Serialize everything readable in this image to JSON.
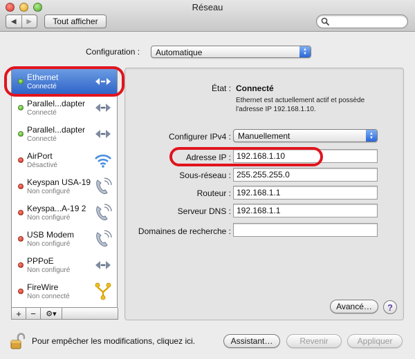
{
  "window": {
    "title": "Réseau"
  },
  "toolbar": {
    "back_glyph": "◀",
    "forward_glyph": "▶",
    "show_all_label": "Tout afficher",
    "search": {
      "value": "",
      "placeholder": ""
    }
  },
  "configuration": {
    "label": "Configuration :",
    "value": "Automatique"
  },
  "sidebar": {
    "items": [
      {
        "name": "Ethernet",
        "status": "Connecté",
        "indicator": "green",
        "icon": "ethernet-arrows-icon",
        "selected": true
      },
      {
        "name": "Parallel...dapter",
        "status": "Connecté",
        "indicator": "green",
        "icon": "ethernet-arrows-icon",
        "selected": false
      },
      {
        "name": "Parallel...dapter",
        "status": "Connecté",
        "indicator": "green",
        "icon": "ethernet-arrows-icon",
        "selected": false
      },
      {
        "name": "AirPort",
        "status": "Désactivé",
        "indicator": "red",
        "icon": "wifi-icon",
        "selected": false
      },
      {
        "name": "Keyspan USA-19",
        "status": "Non configuré",
        "indicator": "red",
        "icon": "phone-icon",
        "selected": false
      },
      {
        "name": "Keyspa...A-19 2",
        "status": "Non configuré",
        "indicator": "red",
        "icon": "phone-icon",
        "selected": false
      },
      {
        "name": "USB Modem",
        "status": "Non configuré",
        "indicator": "red",
        "icon": "phone-icon",
        "selected": false
      },
      {
        "name": "PPPoE",
        "status": "Non configuré",
        "indicator": "red",
        "icon": "ethernet-arrows-icon",
        "selected": false
      },
      {
        "name": "FireWire",
        "status": "Non connecté",
        "indicator": "red",
        "icon": "firewire-icon",
        "selected": false
      }
    ],
    "toolbar": {
      "add": "+",
      "remove": "−",
      "action": "⚙▾"
    }
  },
  "details": {
    "state_label": "État :",
    "state_value": "Connecté",
    "state_description": "Ethernet est actuellement actif et possède l'adresse IP 192.168.1.10.",
    "ipv4_label": "Configurer IPv4 :",
    "ipv4_value": "Manuellement",
    "fields": [
      {
        "label": "Adresse IP :",
        "value": "192.168.1.10"
      },
      {
        "label": "Sous-réseau :",
        "value": "255.255.255.0"
      },
      {
        "label": "Routeur :",
        "value": "192.168.1.1"
      },
      {
        "label": "Serveur DNS :",
        "value": "192.168.1.1"
      },
      {
        "label": "Domaines de recherche :",
        "value": ""
      }
    ],
    "advanced_label": "Avancé…",
    "help_label": "?"
  },
  "footer": {
    "lock_text": "Pour empêcher les modifications, cliquez ici.",
    "assistant_label": "Assistant…",
    "revert_label": "Revenir",
    "apply_label": "Appliquer"
  },
  "colors": {
    "selection": "#3a6fd0",
    "annotation": "#e0141e",
    "connected": "#3fa11f",
    "disconnected": "#c62314"
  }
}
